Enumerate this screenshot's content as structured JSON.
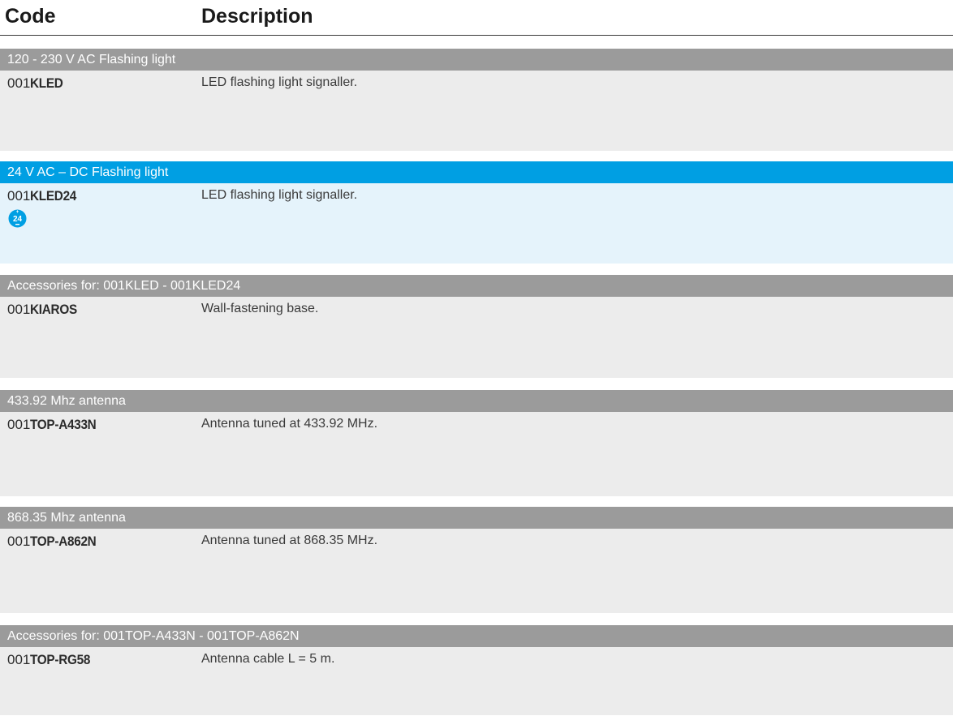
{
  "header": {
    "code_label": "Code",
    "description_label": "Description"
  },
  "sections": [
    {
      "title": "120 - 230 V AC Flashing light",
      "code_prefix": "001",
      "code_name": "KLED",
      "description": "LED flashing light signaller."
    },
    {
      "title": "24 V AC – DC Flashing light",
      "code_prefix": "001",
      "code_name": "KLED24",
      "description": "LED flashing light signaller.",
      "badge": {
        "text": "24",
        "icon": "24v-power-icon",
        "color": "#009fe3"
      }
    },
    {
      "title": "Accessories for: 001KLED - 001KLED24",
      "code_prefix": "001",
      "code_name": "KIAROS",
      "description": "Wall-fastening base."
    },
    {
      "title": "433.92 Mhz antenna",
      "code_prefix": "001",
      "code_name": "TOP-A433N",
      "description": "Antenna tuned at 433.92 MHz."
    },
    {
      "title": "868.35 Mhz antenna",
      "code_prefix": "001",
      "code_name": "TOP-A862N",
      "description": "Antenna tuned at 868.35 MHz."
    },
    {
      "title": "Accessories for: 001TOP-A433N - 001TOP-A862N",
      "code_prefix": "001",
      "code_name": "TOP-RG58",
      "description": "Antenna cable L = 5 m."
    }
  ],
  "colors": {
    "gray_header": "#9b9b9b",
    "blue_header": "#009fe3",
    "gray_body": "#ececec",
    "blue_body": "#e5f3fb"
  }
}
